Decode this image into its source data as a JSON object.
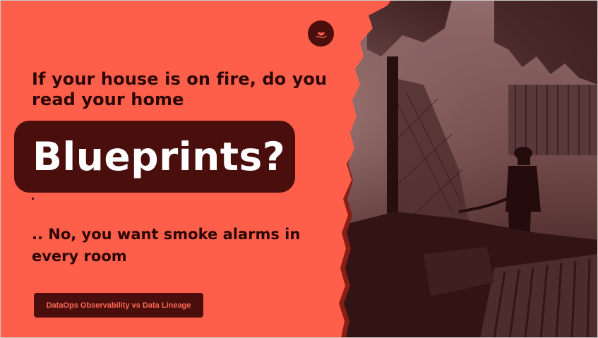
{
  "slide": {
    "heading": "If your house is on fire, do you read your home",
    "highlight": "Blueprints?",
    "answer": ".. No, you want smoke alarms in every room",
    "tag": "DataOps Observability vs Data Lineage"
  },
  "icons": {
    "logo": "heart-in-hand-icon",
    "photo": "firefighter-in-burned-ruins-photo"
  },
  "colors": {
    "background": "#fe5f4a",
    "dark": "#4a0e0c",
    "text": "#2b0706",
    "highlight_text": "#ffffff",
    "tag_text": "#fe6a55"
  }
}
